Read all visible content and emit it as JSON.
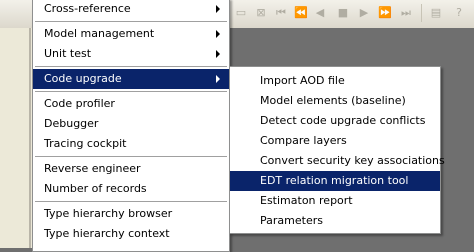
{
  "main_menu": {
    "items": [
      {
        "label": "Cross-reference",
        "submenu": true
      },
      {
        "label": "Model management",
        "submenu": true
      },
      {
        "label": "Unit test",
        "submenu": true
      },
      {
        "label": "Code upgrade",
        "submenu": true,
        "highlighted": true
      },
      {
        "label": "Code profiler"
      },
      {
        "label": "Debugger"
      },
      {
        "label": "Tracing cockpit"
      },
      {
        "label": "Reverse engineer"
      },
      {
        "label": "Number of records"
      },
      {
        "label": "Type hierarchy browser"
      },
      {
        "label": "Type hierarchy context"
      }
    ]
  },
  "sub_menu": {
    "items": [
      {
        "label": "Import AOD file"
      },
      {
        "label": "Model elements (baseline)"
      },
      {
        "label": "Detect code upgrade conflicts"
      },
      {
        "label": "Compare layers"
      },
      {
        "label": "Convert security key associations"
      },
      {
        "label": "EDT relation migration tool",
        "highlighted": true
      },
      {
        "label": "Estimaton report"
      },
      {
        "label": "Parameters"
      }
    ]
  },
  "toolbar": {
    "icons": [
      "close-icon",
      "first-record-icon",
      "previous-page-icon",
      "previous-record-icon",
      "stop-icon",
      "next-record-icon",
      "next-page-icon",
      "last-record-icon",
      "document-icon",
      "help-icon"
    ]
  },
  "colors": {
    "highlight": "#0a246a",
    "menu_background": "#ffffff",
    "app_background": "#6f6f6f"
  }
}
